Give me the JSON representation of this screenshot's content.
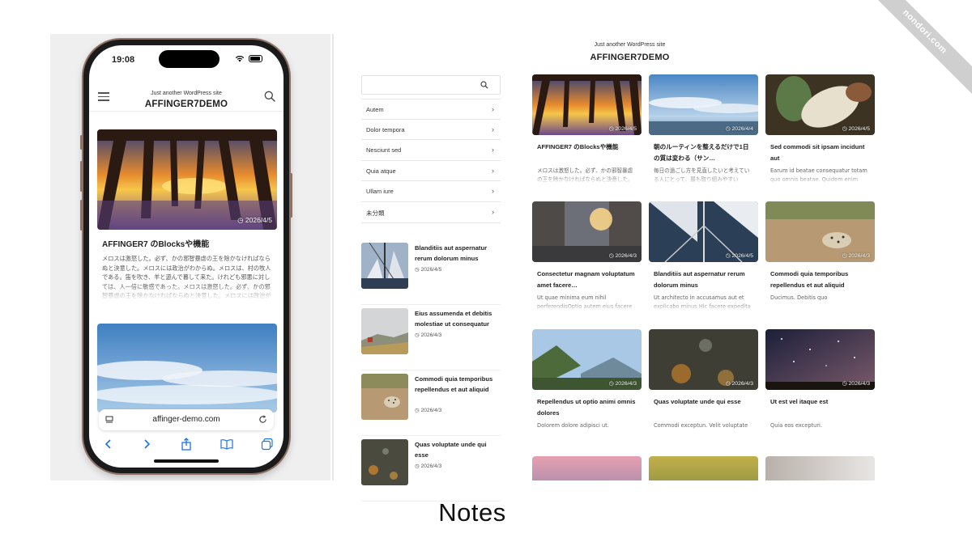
{
  "watermark": "nondori.com",
  "caption": "Notes",
  "phone": {
    "time": "19:08",
    "tagline": "Just another WordPress site",
    "site_name": "AFFINGER7DEMO",
    "post1": {
      "date": "2026/4/5",
      "title": "AFFINGER7 のBlocksや機能",
      "excerpt": "メロスは激怒した。必ず、かの邪智暴虐の王を除かなければならぬと決意した。メロスには政治がわからぬ。メロスは、村の牧人である。笛を吹き、羊と遊んで暮して来た。けれども邪悪に対しては、人一倍に敏感であった。メロスは激怒した。必ず、かの邪智暴虐の王を除かなければならぬと決意した。メロスには政治がわからぬ。"
    },
    "url": "affinger-demo.com"
  },
  "desktop": {
    "tagline": "Just another WordPress site",
    "site_name": "AFFINGER7DEMO",
    "categories": [
      "Autem",
      "Dolor tempora",
      "Nesciunt sed",
      "Quia atque",
      "Ullam iure",
      "未分類"
    ],
    "side_posts": [
      {
        "title": "Blanditiis aut aspernatur rerum dolorum minus",
        "date": "2026/4/5"
      },
      {
        "title": "Eius assumenda et debitis molestiae ut consequatur",
        "date": "2026/4/3"
      },
      {
        "title": "Commodi quia temporibus repellendus et aut aliquid",
        "date": "2026/4/3"
      },
      {
        "title": "Quas voluptate unde qui esse",
        "date": "2026/4/3"
      }
    ],
    "grid_posts": [
      {
        "date": "2026/4/5",
        "title": "AFFINGER7 のBlocksや機能",
        "excerpt": "メロスは激怒した。必ず、かの邪智暴虐の王を除かなければならぬと決意した。メロスには政治がわからぬ。"
      },
      {
        "date": "2026/4/4",
        "title": "朝のルーティンを整えるだけで1日の質は変わる（サン…",
        "excerpt": "毎日の過ごし方を見直したいと考えている人にとって、最も取り組みやすい"
      },
      {
        "date": "2026/4/5",
        "title": "Sed commodi sit ipsam incidunt aut",
        "excerpt": "Earum id beatae consequatur totam quo omnis beatae. Quidem enim"
      },
      {
        "date": "2026/4/3",
        "title": "Consectetur magnam voluptatum amet facere…",
        "excerpt": "Ut quae minima eum nihil perferendisOptio autem eius facere"
      },
      {
        "date": "2026/4/5",
        "title": "Blanditiis aut aspernatur rerum dolorum minus",
        "excerpt": "Ut architecto in accusamus aut et explicabo minus Hic facere expedita"
      },
      {
        "date": "2026/4/3",
        "title": "Commodi quia temporibus repellendus et aut aliquid",
        "excerpt": "Ducimus. Debitis quo"
      },
      {
        "date": "2026/4/3",
        "title": "Repellendus ut optio animi omnis dolores",
        "excerpt": "Dolorem dolore adipisci ut."
      },
      {
        "date": "2026/4/3",
        "title": "Quas voluptate unde qui esse",
        "excerpt": "Commodi exceptun. Velit voluptate"
      },
      {
        "date": "2026/4/3",
        "title": "Ut est vel itaque est",
        "excerpt": "Quia eos excepturi."
      }
    ]
  }
}
